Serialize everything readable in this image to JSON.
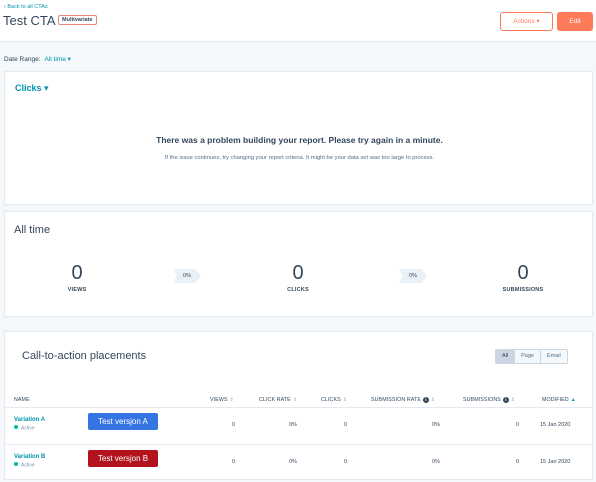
{
  "header": {
    "back_link": "‹ Back to all CTAs",
    "title": "Test CTA",
    "badge": "Multivariate",
    "actions_label": "Actions ▾",
    "edit_label": "Edit"
  },
  "date_range": {
    "label": "Date Range:",
    "value": "All time ▾"
  },
  "report": {
    "metric_dropdown": "Clicks ▾",
    "error_title": "There was a problem building your report. Please try again in a minute.",
    "error_subtitle": "If the issue continues, try changing your report criteria. It might be your data set was too large to process."
  },
  "all_time": {
    "title": "All time",
    "views": {
      "value": "0",
      "label": "VIEWS"
    },
    "rate_1": "0%",
    "clicks": {
      "value": "0",
      "label": "CLICKS"
    },
    "rate_2": "0%",
    "submissions": {
      "value": "0",
      "label": "SUBMISSIONS"
    }
  },
  "placements": {
    "title": "Call-to-action placements",
    "filters": [
      "All",
      "Page",
      "Email"
    ],
    "active_filter": "All",
    "columns": {
      "name": "NAME",
      "views": "VIEWS",
      "click_rate": "CLICK RATE",
      "clicks": "CLICKS",
      "submission_rate": "SUBMISSION RATE",
      "submissions": "SUBMISSIONS",
      "modified": "MODIFIED"
    },
    "rows": [
      {
        "name": "Variation A",
        "status": "Active",
        "cta_label": "Test versjon A",
        "cta_color": "#3574e3",
        "views": "0",
        "click_rate": "0%",
        "clicks": "0",
        "submission_rate": "0%",
        "submissions": "0",
        "modified": "15 Jan 2020"
      },
      {
        "name": "Variation B",
        "status": "Active",
        "cta_label": "Test versjon B",
        "cta_color": "#b3131c",
        "views": "0",
        "click_rate": "0%",
        "clicks": "0",
        "submission_rate": "0%",
        "submissions": "0",
        "modified": "15 Jan 2020"
      }
    ]
  },
  "colors": {
    "accent": "#0091ae",
    "primary_button": "#ff7a59",
    "status_active": "#00bda5"
  }
}
